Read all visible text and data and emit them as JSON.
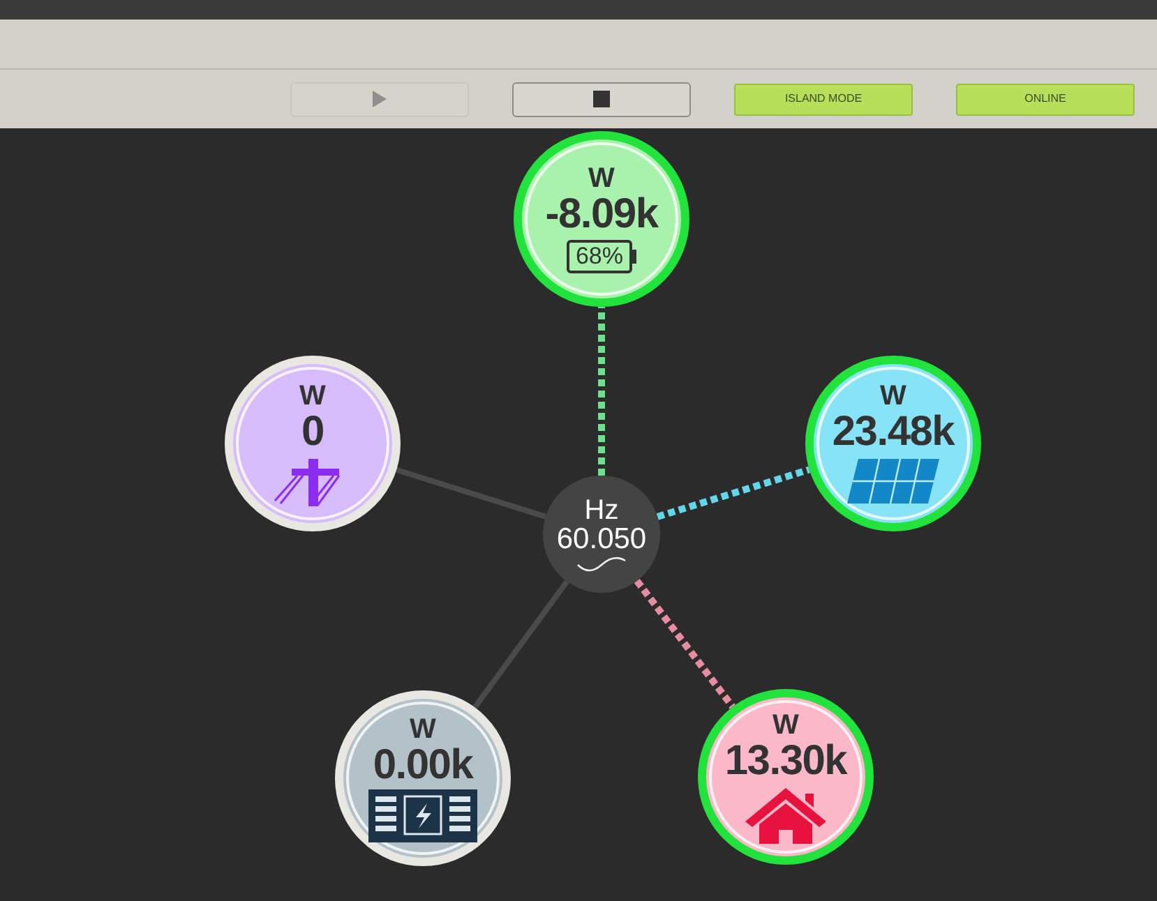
{
  "toolbar": {
    "buttons": [
      {
        "kind": "play",
        "disabled": true
      },
      {
        "kind": "stop",
        "disabled": false
      }
    ],
    "status": [
      {
        "label": "ISLAND MODE",
        "on": true
      },
      {
        "label": "ONLINE",
        "on": true
      }
    ]
  },
  "hub": {
    "unit": "Hz",
    "value": "60.050"
  },
  "nodes": [
    {
      "kind": "battery",
      "unit": "W",
      "value": "-8.09k",
      "charge": "68%",
      "active": true,
      "color": "#a9f2ad"
    },
    {
      "kind": "grid",
      "unit": "W",
      "value": "0",
      "active": false,
      "color": "#d6bcfb"
    },
    {
      "kind": "solar",
      "unit": "W",
      "value": "23.48k",
      "active": true,
      "color": "#86e4f6"
    },
    {
      "kind": "generator",
      "unit": "W",
      "value": "0.00k",
      "active": false,
      "color": "#b3c2c8"
    },
    {
      "kind": "load",
      "unit": "W",
      "value": "13.30k",
      "active": true,
      "color": "#fbb8c8"
    }
  ]
}
